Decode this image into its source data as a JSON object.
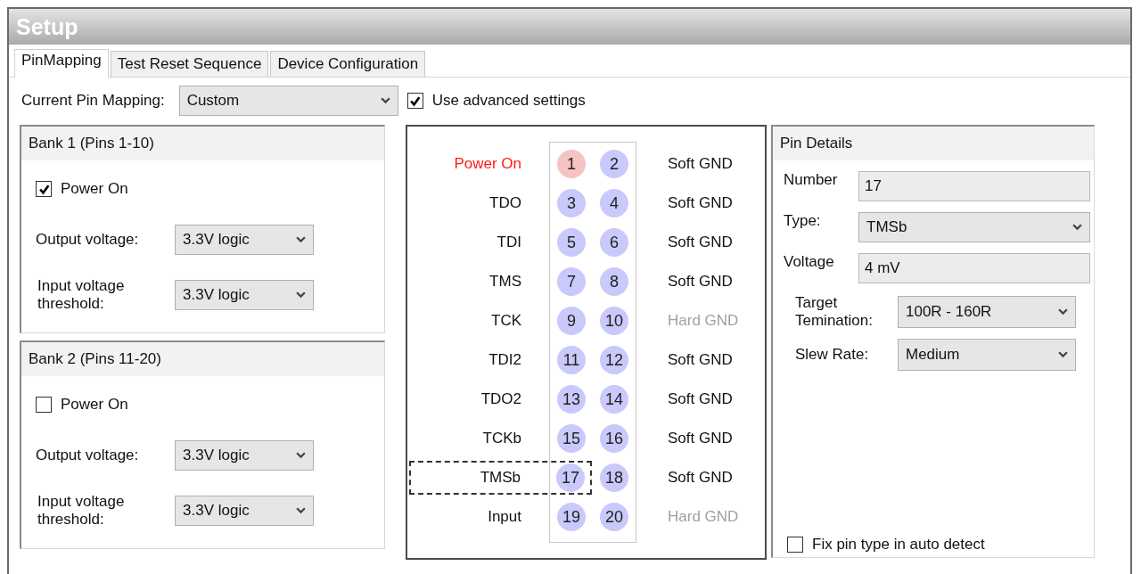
{
  "window": {
    "title": "Setup"
  },
  "tabs": [
    {
      "label": "PinMapping",
      "selected": true
    },
    {
      "label": "Test Reset Sequence",
      "selected": false
    },
    {
      "label": "Device Configuration",
      "selected": false
    }
  ],
  "mapping": {
    "label": "Current Pin Mapping:",
    "value": "Custom"
  },
  "advanced": {
    "label": "Use advanced settings",
    "checked": true
  },
  "banks": [
    {
      "title": "Bank 1 (Pins 1-10)",
      "power": {
        "label": "Power On",
        "checked": true
      },
      "output": {
        "label": "Output voltage:",
        "value": "3.3V logic"
      },
      "threshold": {
        "label": "Input voltage threshold:",
        "value": "3.3V logic"
      }
    },
    {
      "title": "Bank 2 (Pins 11-20)",
      "power": {
        "label": "Power On",
        "checked": false
      },
      "output": {
        "label": "Output voltage:",
        "value": "3.3V logic"
      },
      "threshold": {
        "label": "Input voltage threshold:",
        "value": "3.3V logic"
      }
    }
  ],
  "pins": [
    {
      "signal": "Power On",
      "pin": "1",
      "powered": true,
      "pair_pin": "2",
      "ground": "Soft GND",
      "ground_disabled": false,
      "selected": false
    },
    {
      "signal": "TDO",
      "pin": "3",
      "powered": false,
      "pair_pin": "4",
      "ground": "Soft GND",
      "ground_disabled": false,
      "selected": false
    },
    {
      "signal": "TDI",
      "pin": "5",
      "powered": false,
      "pair_pin": "6",
      "ground": "Soft GND",
      "ground_disabled": false,
      "selected": false
    },
    {
      "signal": "TMS",
      "pin": "7",
      "powered": false,
      "pair_pin": "8",
      "ground": "Soft GND",
      "ground_disabled": false,
      "selected": false
    },
    {
      "signal": "TCK",
      "pin": "9",
      "powered": false,
      "pair_pin": "10",
      "ground": "Hard GND",
      "ground_disabled": true,
      "selected": false
    },
    {
      "signal": "TDI2",
      "pin": "11",
      "powered": false,
      "pair_pin": "12",
      "ground": "Soft GND",
      "ground_disabled": false,
      "selected": false
    },
    {
      "signal": "TDO2",
      "pin": "13",
      "powered": false,
      "pair_pin": "14",
      "ground": "Soft GND",
      "ground_disabled": false,
      "selected": false
    },
    {
      "signal": "TCKb",
      "pin": "15",
      "powered": false,
      "pair_pin": "16",
      "ground": "Soft GND",
      "ground_disabled": false,
      "selected": false
    },
    {
      "signal": "TMSb",
      "pin": "17",
      "powered": false,
      "pair_pin": "18",
      "ground": "Soft GND",
      "ground_disabled": false,
      "selected": true
    },
    {
      "signal": "Input",
      "pin": "19",
      "powered": false,
      "pair_pin": "20",
      "ground": "Hard GND",
      "ground_disabled": true,
      "selected": false
    }
  ],
  "pin_details": {
    "title": "Pin Details",
    "fields": [
      {
        "kind": "text",
        "label": "Number",
        "value": "17"
      },
      {
        "kind": "dropdown",
        "label": "Type:",
        "value": "TMSb"
      },
      {
        "kind": "text",
        "label": "Voltage",
        "value": "4 mV"
      },
      {
        "kind": "option",
        "label": "Target Temination:",
        "value": "100R - 160R"
      },
      {
        "kind": "option",
        "label": "Slew Rate:",
        "value": "Medium"
      }
    ],
    "fix_type": {
      "label": "Fix pin type in auto detect",
      "checked": false
    }
  }
}
